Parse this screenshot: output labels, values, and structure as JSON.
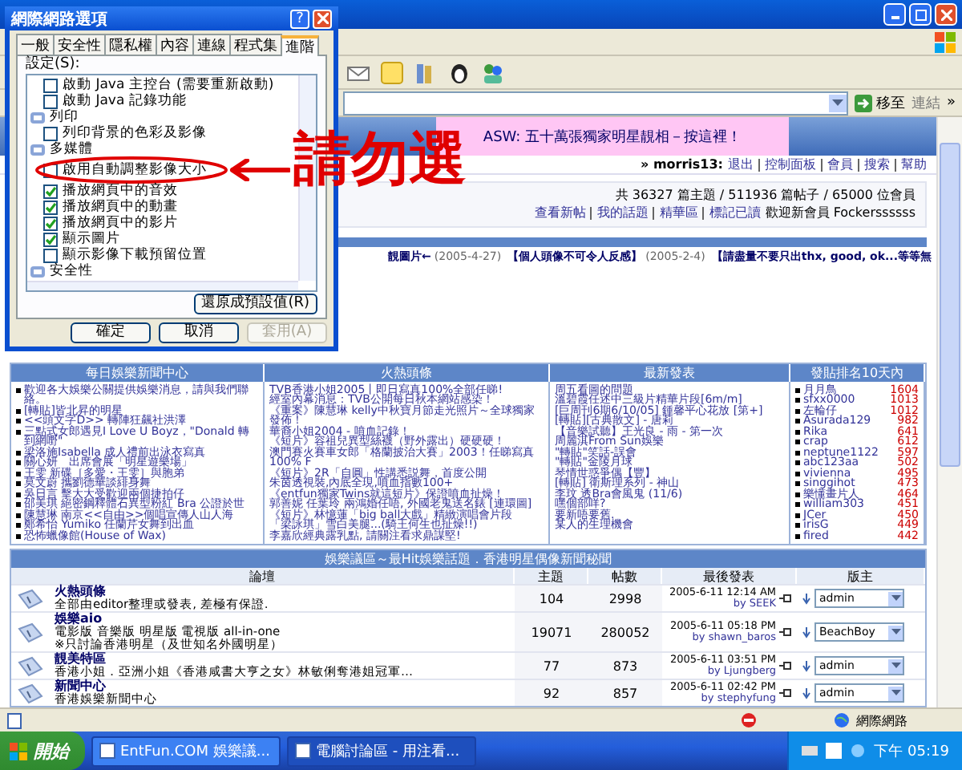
{
  "browser": {
    "address_bar": {
      "go_button": "移至",
      "links_label": "連結",
      "chevron": "»"
    },
    "page": {
      "banner": "ASW: 五十萬張獨家明星靚相－按這裡！",
      "user_nav": {
        "user": "» morris13:",
        "links": [
          "退出",
          "控制面板",
          "會員",
          "搜索",
          "幫助"
        ]
      },
      "stats": "共 36327 篇主題 / 511936 篇帖子 / 65000 位會員",
      "quick_links": [
        "查看新帖",
        "我的話題",
        "精華區",
        "標記已讀"
      ],
      "welcome": "歡迎新會員 Fockerssssss",
      "announcements": [
        {
          "title": "靚圖片←",
          "date": "(2005-4-27)"
        },
        {
          "title": "【個人頭像不可令人反感】",
          "date": "(2005-2-4)"
        },
        {
          "title": "【請盡量不要只出thx, good, ok...等等無"
        }
      ],
      "panels": [
        {
          "kind": "news",
          "title": "每日娛樂新聞中心",
          "items": [
            "歡迎各大娛樂公關提供娛樂消息，請與我們聯絡。",
            "[轉貼]皆北昇的明星",
            "<<頭文字D>> 轉陣狂飆社洪澤",
            "三點式女郎遇見I Love U Boyz，\"Donald 轉到網嘢\"",
            "梁洛施Isabella 成人禮前出泳衣寫真",
            "關心妍　出席會展「明星遊樂場」",
            "王雯 新碟［多愛・王雯］與胞弟",
            "莫文蔚 攜劉德華談緋身舞",
            "吳日言 擊大大受歡迎兩個捷拍仔",
            "邵美琪 絕密鋼釋體石異型粉紅 Bra 公證於世",
            "陳慧琳 南京<<自由>>個唱宣傳人山人海",
            "鄭希怡 Yumiko 任蘭芹女舞到出血",
            "恐怖蠟像館(House of Wax)"
          ]
        },
        {
          "kind": "plain",
          "title": "火熱頭條",
          "items": [
            "TVB香港小姐2005丨即日寫真100%全部任睇!",
            "經室內幕消息：TVB公開每日秋本網站感染！",
            "《重案》陳慧琳 kelly中秋寶月節走光照片～全球獨家發佈！",
            "華裔小姐2004 - 噴血記錄！",
            "《短片》容祖兒異型絲襪（野外露出）硬硬硬！",
            "澳門賽火賽車女郎「格蘭披治大賽」2003！任睇寫真100% F",
            "《短片》2R「自圓」性講悉説舞，首度公開",
            "朱茵透視裝,內底全現,噴血指數100+",
            "《entfun獨家Twins就這短片》保證噴血扯燥！",
            "郭善妮 任葉玲 兩鴻婚任唔, 外國老鬼送名錶 [連環圖]",
            "《短片》林憶蓮「big ball大戲」精緻演唱會片段",
            "「梁詠琪」雪白美腿...(騎王何生也扯燥!!)",
            "李嘉欣經典露乳點, 請關注看求鼎謀堅!"
          ]
        },
        {
          "kind": "plain",
          "title": "最新發表",
          "items": [
            "周五看圖的問題",
            "溫碧霞任述中三級片精華片段[6m/m]",
            "[巨周刊6期6/10/05] 鍾馨平心花放 [第+]",
            "[轉貼][古典散文] - 唐莉",
            "【音樂試聽】王光良 - 雨 - 第一次",
            "周麗淇From Sun娛樂",
            "\"轉貼\"笑話-誤會",
            "\"轉貼\"金陵月球",
            "琴情世惑爭偶【豐】",
            "[轉貼] 衛斯理系列 - 神山",
            "李玟 透Bra會風鬼 (11/6)",
            "嘿個部咩?",
            "要新唔要舊.",
            "某人的生理機會"
          ]
        },
        {
          "kind": "ranking",
          "title": "發貼排名10天內",
          "items": [
            {
              "name": "月月鳥",
              "count": "1604"
            },
            {
              "name": "sfxx0000",
              "count": "1013"
            },
            {
              "name": "左輪仔",
              "count": "1012"
            },
            {
              "name": "Asurada129",
              "count": "982"
            },
            {
              "name": "Rika",
              "count": "641"
            },
            {
              "name": "crap",
              "count": "612"
            },
            {
              "name": "neptune1122",
              "count": "597"
            },
            {
              "name": "abc123aa",
              "count": "502"
            },
            {
              "name": "vivienna",
              "count": "495"
            },
            {
              "name": "singgihot",
              "count": "473"
            },
            {
              "name": "樂懂畫片人",
              "count": "464"
            },
            {
              "name": "william303",
              "count": "451"
            },
            {
              "name": "JCer",
              "count": "450"
            },
            {
              "name": "irisG",
              "count": "449"
            },
            {
              "name": "fired",
              "count": "442"
            }
          ]
        }
      ],
      "forum": {
        "title": "娛樂議區～最Hit娛樂話題．香港明星偶像新聞秘聞",
        "columns": [
          "論壇",
          "主題",
          "帖數",
          "最後發表",
          "版主"
        ],
        "rows": [
          {
            "name": "火熱頭條",
            "description": [
              "全部由editor整理或發表, 差極有保證."
            ],
            "topics": "104",
            "posts": "2998",
            "last_post_time": "2005-6-11 12:14 AM",
            "last_post_by": "by SEEK",
            "moderator": "admin"
          },
          {
            "name": "娛樂aio",
            "description": [
              "電影版 音樂版 明星版 電視版 all-in-one",
              "※只討論香港明星（及世知名外國明星）"
            ],
            "topics": "19071",
            "posts": "280052",
            "last_post_time": "2005-6-11 05:18 PM",
            "last_post_by": "by shawn_baros",
            "moderator": "BeachBoy"
          },
          {
            "name": "靚美特區",
            "description": [
              "香港小姐．亞洲小姐《香港咸書大亨之女》林敏俐奪港姐冠軍…"
            ],
            "topics": "77",
            "posts": "873",
            "last_post_time": "2005-6-11 03:51 PM",
            "last_post_by": "by Ljungberg",
            "moderator": "admin"
          },
          {
            "name": "新聞中心",
            "description": [
              "香港娛樂新聞中心"
            ],
            "topics": "92",
            "posts": "857",
            "last_post_time": "2005-6-11 02:42 PM",
            "last_post_by": "by stephyfung",
            "moderator": "admin"
          }
        ]
      }
    },
    "status_bar": {
      "zone": "網際網路"
    }
  },
  "dialog": {
    "title": "網際網路選項",
    "help_button": "?",
    "tabs": [
      {
        "label": "一般",
        "selected": false
      },
      {
        "label": "安全性",
        "selected": false
      },
      {
        "label": "隱私權",
        "selected": false
      },
      {
        "label": "內容",
        "selected": false
      },
      {
        "label": "連線",
        "selected": false
      },
      {
        "label": "程式集",
        "selected": false
      },
      {
        "label": "進階",
        "selected": true
      }
    ],
    "settings_label": "設定(S):",
    "settings": [
      {
        "kind": "checkbox",
        "label": "啟動 Java 主控台 (需要重新啟動)",
        "checked": false
      },
      {
        "kind": "checkbox",
        "label": "啟動 Java 記錄功能",
        "checked": false
      },
      {
        "kind": "category",
        "label": "列印"
      },
      {
        "kind": "checkbox",
        "label": "列印背景的色彩及影像",
        "checked": false
      },
      {
        "kind": "category",
        "label": "多媒體"
      },
      {
        "kind": "checkbox",
        "label": "啟用自動調整影像大小",
        "checked": false,
        "annotation": "請勿選"
      },
      {
        "kind": "checkbox",
        "label": "播放網頁中的音效",
        "checked": true
      },
      {
        "kind": "checkbox",
        "label": "播放網頁中的動畫",
        "checked": true
      },
      {
        "kind": "checkbox",
        "label": "播放網頁中的影片",
        "checked": true
      },
      {
        "kind": "checkbox",
        "label": "顯示圖片",
        "checked": true
      },
      {
        "kind": "checkbox",
        "label": "顯示影像下載預留位置",
        "checked": false
      },
      {
        "kind": "category",
        "label": "安全性"
      }
    ],
    "restore_button": "還原成預設值(R)",
    "buttons": [
      {
        "label": "確定",
        "disabled": false
      },
      {
        "label": "取消",
        "disabled": false
      },
      {
        "label": "套用(A)",
        "disabled": true
      }
    ]
  },
  "taskbar": {
    "start": "開始",
    "tasks": [
      {
        "label": "EntFun.COM 娛樂議...",
        "selected": false
      },
      {
        "label": "電腦討論區 - 用注看...",
        "selected": true
      }
    ],
    "clock": "下午 05:19"
  }
}
